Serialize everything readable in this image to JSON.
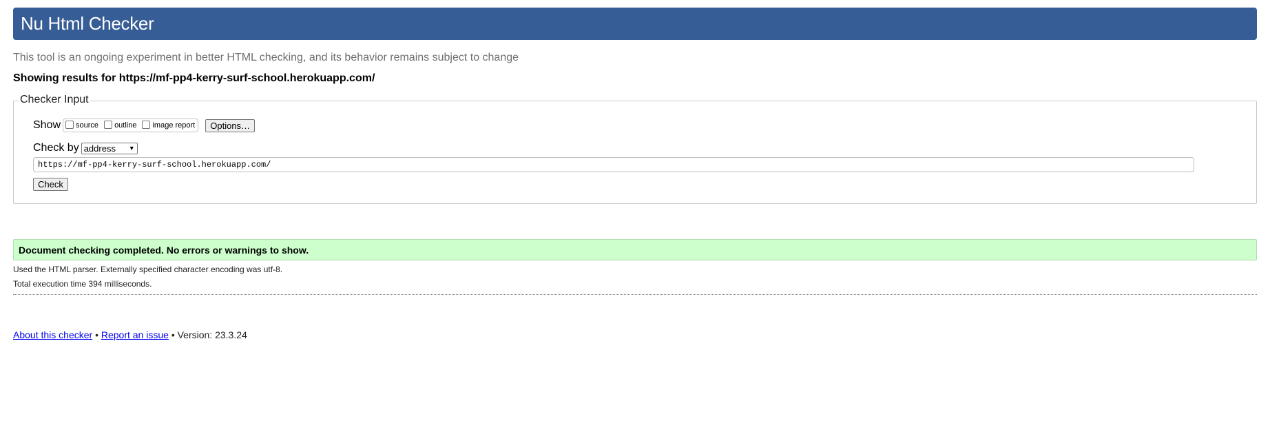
{
  "header": {
    "title": "Nu Html Checker"
  },
  "intro": {
    "subtitle": "This tool is an ongoing experiment in better HTML checking, and its behavior remains subject to change",
    "results_for": "Showing results for https://mf-pp4-kerry-surf-school.herokuapp.com/"
  },
  "checker_input": {
    "legend": "Checker Input",
    "show_label": "Show",
    "show_options": [
      {
        "label": "source",
        "checked": false
      },
      {
        "label": "outline",
        "checked": false
      },
      {
        "label": "image report",
        "checked": false
      }
    ],
    "options_button": "Options…",
    "check_by_label": "Check by",
    "check_by_value": "address",
    "url_value": "https://mf-pp4-kerry-surf-school.herokuapp.com/",
    "check_button": "Check"
  },
  "result": {
    "message": "Document checking completed. No errors or warnings to show.",
    "parser_note": "Used the HTML parser. Externally specified character encoding was utf-8.",
    "execution_time": "Total execution time 394 milliseconds."
  },
  "footer": {
    "about_link": "About this checker",
    "separator": "•",
    "report_link": "Report an issue",
    "version": "Version: 23.3.24"
  },
  "colors": {
    "header_bg": "#365d95",
    "success_bg": "#ccffcc",
    "link": "#0000ee"
  }
}
